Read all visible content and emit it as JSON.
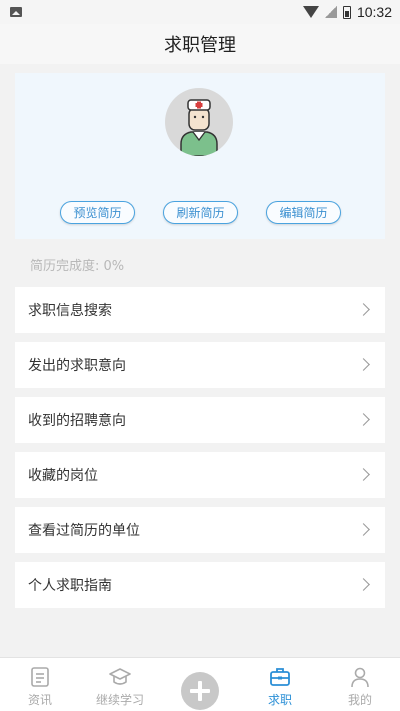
{
  "status_bar": {
    "time": "10:32",
    "icons": [
      "gallery-icon",
      "wifi-icon",
      "signal-icon",
      "battery-icon"
    ]
  },
  "header": {
    "title": "求职管理"
  },
  "profile": {
    "avatar": "doctor-avatar-icon",
    "buttons": {
      "preview": "预览简历",
      "refresh": "刷新简历",
      "edit": "编辑简历"
    },
    "completion_text": "简历完成度: 0%"
  },
  "menu": {
    "items": [
      {
        "label": "求职信息搜索"
      },
      {
        "label": "发出的求职意向"
      },
      {
        "label": "收到的招聘意向"
      },
      {
        "label": "收藏的岗位"
      },
      {
        "label": "查看过简历的单位"
      },
      {
        "label": "个人求职指南"
      }
    ]
  },
  "bottom_nav": {
    "items": [
      {
        "label": "资讯",
        "icon": "news-icon"
      },
      {
        "label": "继续学习",
        "icon": "graduation-cap-icon"
      },
      {
        "label": "",
        "icon": "add-icon"
      },
      {
        "label": "求职",
        "icon": "briefcase-icon",
        "active": true
      },
      {
        "label": "我的",
        "icon": "person-icon"
      }
    ]
  },
  "colors": {
    "accent": "#2b8fd6",
    "card_background": "#f0f7fd",
    "page_background": "#f2f2f2"
  }
}
